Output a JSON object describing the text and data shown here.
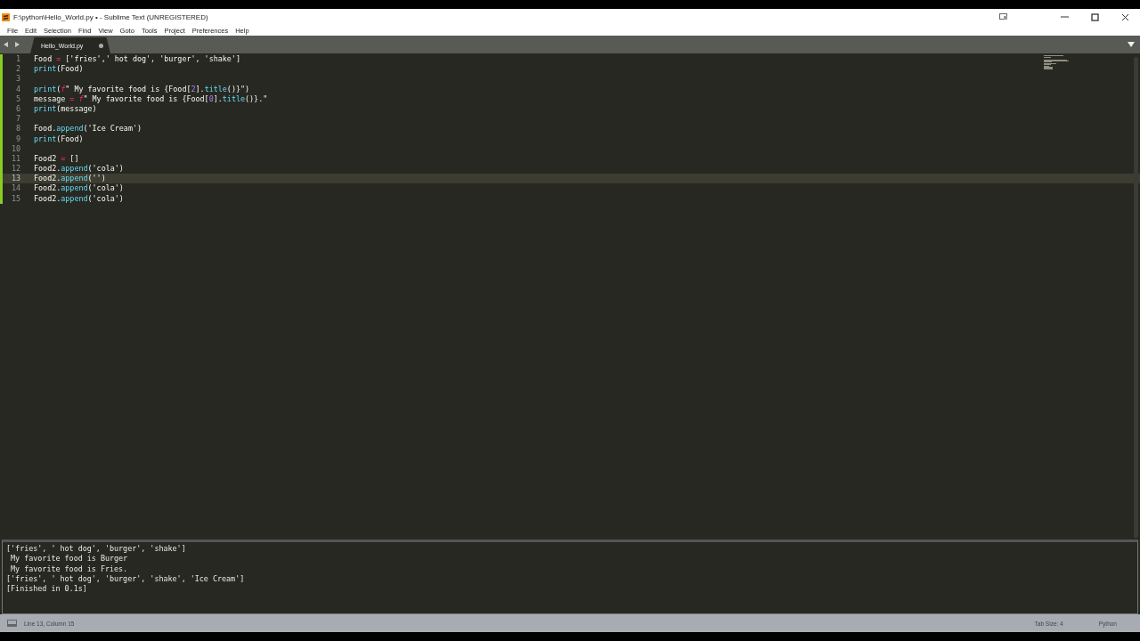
{
  "window": {
    "title": "F:\\python\\Hello_World.py • - Sublime Text (UNREGISTERED)"
  },
  "menu": [
    "File",
    "Edit",
    "Selection",
    "Find",
    "View",
    "Goto",
    "Tools",
    "Project",
    "Preferences",
    "Help"
  ],
  "tabs": [
    {
      "label": "Hello_World.py",
      "selected": true,
      "dirty": true
    }
  ],
  "editor": {
    "lines": [
      {
        "number": "1",
        "selected": false,
        "tokens": [
          {
            "kind": "text",
            "text": "Food "
          },
          {
            "kind": "op",
            "text": "="
          },
          {
            "kind": "text",
            "text": " ['fries',' hot dog', 'burger', 'shake']"
          }
        ]
      },
      {
        "number": "2",
        "selected": false,
        "tokens": [
          {
            "kind": "func",
            "text": "print"
          },
          {
            "kind": "text",
            "text": "(Food)"
          }
        ]
      },
      {
        "number": "3",
        "selected": false
      },
      {
        "number": "4",
        "selected": false,
        "tokens": [
          {
            "kind": "func",
            "text": "print"
          },
          {
            "kind": "text",
            "text": "("
          },
          {
            "kind": "prefix",
            "text": "f"
          },
          {
            "kind": "text",
            "text": "\" My favorite food is {Food["
          },
          {
            "kind": "num",
            "text": "2"
          },
          {
            "kind": "text",
            "text": "]."
          },
          {
            "kind": "func",
            "text": "title"
          },
          {
            "kind": "text",
            "text": "()}\")"
          }
        ]
      },
      {
        "number": "5",
        "selected": false,
        "tokens": [
          {
            "kind": "text",
            "text": "message "
          },
          {
            "kind": "op",
            "text": "="
          },
          {
            "kind": "prefix",
            "text": " f"
          },
          {
            "kind": "text",
            "text": "\" My favorite food is {Food["
          },
          {
            "kind": "num",
            "text": "0"
          },
          {
            "kind": "text",
            "text": "]."
          },
          {
            "kind": "func",
            "text": "title"
          },
          {
            "kind": "text",
            "text": "()}.\""
          }
        ]
      },
      {
        "number": "6",
        "selected": false,
        "tokens": [
          {
            "kind": "func",
            "text": "print"
          },
          {
            "kind": "text",
            "text": "(message)"
          }
        ]
      },
      {
        "number": "7",
        "selected": false
      },
      {
        "number": "8",
        "selected": false,
        "tokens": [
          {
            "kind": "text",
            "text": "Food."
          },
          {
            "kind": "func",
            "text": "append"
          },
          {
            "kind": "text",
            "text": "('Ice Cream')"
          }
        ]
      },
      {
        "number": "9",
        "selected": false,
        "tokens": [
          {
            "kind": "func",
            "text": "print"
          },
          {
            "kind": "text",
            "text": "(Food)"
          }
        ]
      },
      {
        "number": "10",
        "selected": false
      },
      {
        "number": "11",
        "selected": false,
        "tokens": [
          {
            "kind": "text",
            "text": "Food2 "
          },
          {
            "kind": "op",
            "text": "="
          },
          {
            "kind": "text",
            "text": " []"
          }
        ]
      },
      {
        "number": "12",
        "selected": false,
        "tokens": [
          {
            "kind": "text",
            "text": "Food2."
          },
          {
            "kind": "func",
            "text": "append"
          },
          {
            "kind": "text",
            "text": "('cola')"
          }
        ]
      },
      {
        "number": "13",
        "selected": true,
        "tokens": [
          {
            "kind": "text",
            "text": "Food2."
          },
          {
            "kind": "func",
            "text": "append"
          },
          {
            "kind": "text",
            "text": "('')"
          }
        ]
      },
      {
        "number": "14",
        "selected": false,
        "tokens": [
          {
            "kind": "text",
            "text": "Food2."
          },
          {
            "kind": "func",
            "text": "append"
          },
          {
            "kind": "text",
            "text": "('cola')"
          }
        ]
      },
      {
        "number": "15",
        "selected": false,
        "tokens": [
          {
            "kind": "text",
            "text": "Food2."
          },
          {
            "kind": "func",
            "text": "append"
          },
          {
            "kind": "text",
            "text": "('cola')"
          }
        ]
      }
    ]
  },
  "output": [
    "['fries', ' hot dog', 'burger', 'shake']",
    " My favorite food is Burger",
    " My favorite food is Fries.",
    "['fries', ' hot dog', 'burger', 'shake', 'Ice Cream']",
    "[Finished in 0.1s]"
  ],
  "status_bar": {
    "position": "Line 13, Column 15",
    "tab_size": "Tab Size: 4",
    "syntax": "Python"
  }
}
